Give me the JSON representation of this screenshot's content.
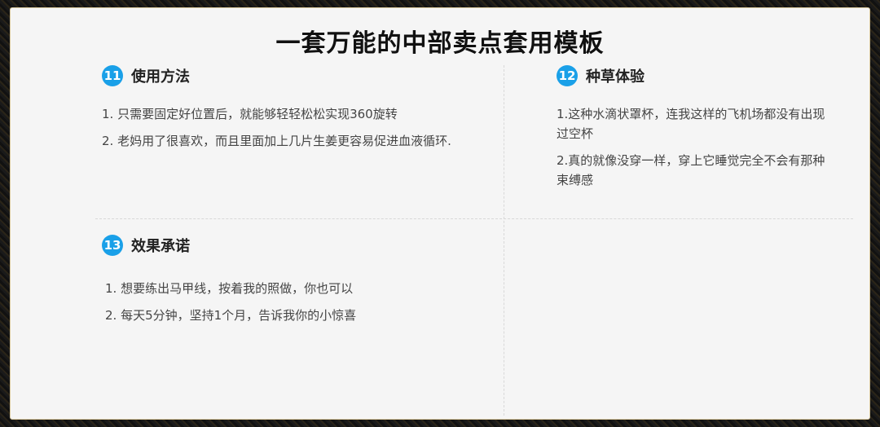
{
  "page": {
    "title": "一套万能的中部卖点套用模板"
  },
  "sections": [
    {
      "number": "11",
      "title": "使用方法",
      "items": [
        "1. 只需要固定好位置后，就能够轻轻松松实现360旋转",
        "2. 老妈用了很喜欢，而且里面加上几片生姜更容易促进血液循环."
      ]
    },
    {
      "number": "12",
      "title": "种草体验",
      "items": [
        "1.这种水滴状罩杯，连我这样的飞机场都没有出现过空杯",
        "2.真的就像没穿一样，穿上它睡觉完全不会有那种束缚感"
      ]
    },
    {
      "number": "13",
      "title": "效果承诺",
      "items": [
        "1. 想要练出马甲线，按着我的照做，你也可以",
        "2. 每天5分钟，坚持1个月，告诉我你的小惊喜"
      ]
    }
  ],
  "colors": {
    "badge": "#1aa0e8",
    "panel": "#f5f5f5",
    "frame": "#111111"
  }
}
